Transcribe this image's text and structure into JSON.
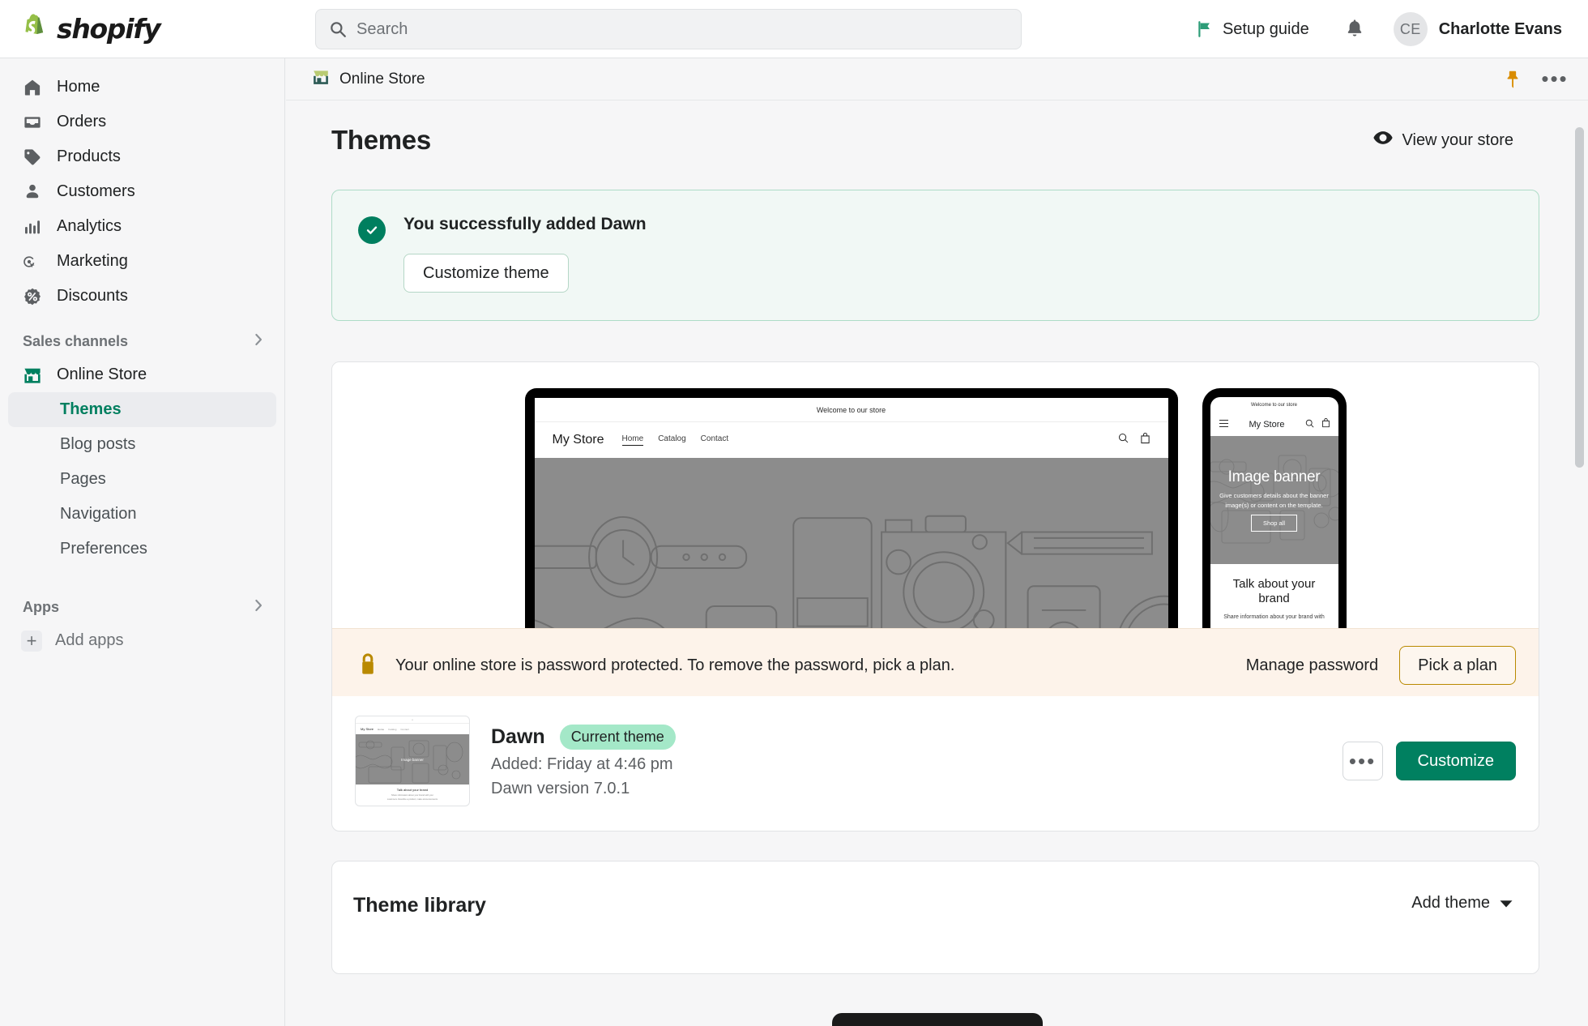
{
  "topbar": {
    "brand": "shopify",
    "search": {
      "placeholder": "Search"
    },
    "setup_guide_label": "Setup guide",
    "notifications_label": "",
    "user": {
      "initials": "CE",
      "name": "Charlotte Evans"
    }
  },
  "sidebar": {
    "main_items": [
      {
        "label": "Home",
        "icon": "home-icon"
      },
      {
        "label": "Orders",
        "icon": "orders-icon"
      },
      {
        "label": "Products",
        "icon": "products-tag-icon"
      },
      {
        "label": "Customers",
        "icon": "customers-person-icon"
      },
      {
        "label": "Analytics",
        "icon": "analytics-bars-icon"
      },
      {
        "label": "Marketing",
        "icon": "marketing-target-icon"
      },
      {
        "label": "Discounts",
        "icon": "discounts-percent-icon"
      }
    ],
    "sales_channels_label": "Sales channels",
    "online_store_label": "Online Store",
    "sub_items": [
      {
        "label": "Themes",
        "selected": true
      },
      {
        "label": "Blog posts",
        "selected": false
      },
      {
        "label": "Pages",
        "selected": false
      },
      {
        "label": "Navigation",
        "selected": false
      },
      {
        "label": "Preferences",
        "selected": false
      }
    ],
    "apps_label": "Apps",
    "add_apps_label": "Add apps"
  },
  "context_bar": {
    "title": "Online Store",
    "pin_icon": "pin-icon",
    "more_icon": "ellipsis-icon"
  },
  "page": {
    "title": "Themes",
    "view_store_label": "View your store"
  },
  "success_banner": {
    "title": "You successfully added Dawn",
    "button_label": "Customize theme",
    "accent_color": "#007f5f",
    "background_color": "#f1f8f5"
  },
  "preview": {
    "desktop": {
      "announcement": "Welcome to our store",
      "store_name": "My Store",
      "nav_links": [
        "Home",
        "Catalog",
        "Contact"
      ]
    },
    "mobile": {
      "announcement": "Welcome to our store",
      "store_name": "My Store",
      "hero_title": "Image banner",
      "hero_text": "Give customers details about the banner image(s) or content on the template.",
      "hero_button": "Shop all",
      "section_title": "Talk about your brand",
      "section_text": "Share information about your brand with"
    }
  },
  "password_banner": {
    "message": "Your online store is password protected. To remove the password, pick a plan.",
    "manage_label": "Manage password",
    "plan_label": "Pick a plan",
    "background_color": "#fdf3ea",
    "lock_icon": "lock-icon"
  },
  "theme_row": {
    "name": "Dawn",
    "badge": "Current theme",
    "added": "Added: Friday at 4:46 pm",
    "version": "Dawn version 7.0.1",
    "more_label": "•••",
    "customize_label": "Customize",
    "primary_color": "#008060"
  },
  "theme_library": {
    "title": "Theme library",
    "add_theme_label": "Add theme"
  }
}
